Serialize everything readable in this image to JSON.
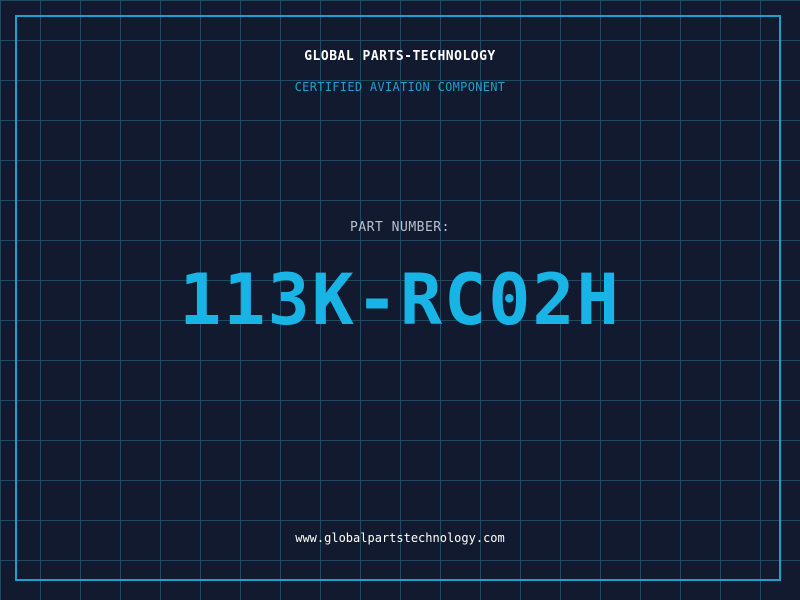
{
  "header": {
    "company": "GLOBAL PARTS-TECHNOLOGY",
    "subtitle": "CERTIFIED AVIATION COMPONENT"
  },
  "part": {
    "label": "PART NUMBER:",
    "number": "113K-RC02H"
  },
  "footer": {
    "website": "www.globalpartstechnology.com"
  },
  "colors": {
    "background": "#111a2e",
    "grid": "#1f4a63",
    "accent": "#1ea0cf",
    "part_number": "#19b4e6",
    "label": "#b8c1cf",
    "text": "#ffffff"
  }
}
